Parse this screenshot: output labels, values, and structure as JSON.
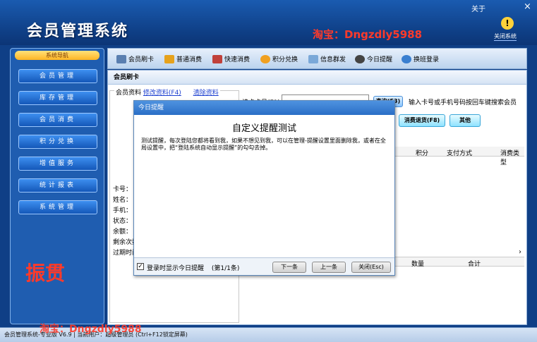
{
  "header": {
    "app_title": "会员管理系统",
    "watermark_shop": "淘宝：Dngzdly5988",
    "about": "关于",
    "close_x": "×",
    "warn_glyph": "!",
    "close_system": "关闭系统"
  },
  "sidebar": {
    "heading": "系统导航",
    "items": [
      "会员管理",
      "库存管理",
      "会员消费",
      "积分兑换",
      "增值服务",
      "统计报表",
      "系统管理"
    ]
  },
  "toolbar": {
    "items": [
      {
        "label": "会员刷卡",
        "icon": "card-icon",
        "color": "#5a7fb0"
      },
      {
        "label": "普通消费",
        "icon": "cash-icon",
        "color": "#e6a21c"
      },
      {
        "label": "快速消费",
        "icon": "fast-icon",
        "color": "#c0403a"
      },
      {
        "label": "积分兑换",
        "icon": "points-icon",
        "color": "#f0a020"
      },
      {
        "label": "信息群发",
        "icon": "mail-icon",
        "color": "#7aa8d8"
      },
      {
        "label": "今日提醒",
        "icon": "clock-icon",
        "color": "#444444"
      },
      {
        "label": "换班登录",
        "icon": "switch-icon",
        "color": "#3a7fd0"
      }
    ]
  },
  "main": {
    "title": "会员刷卡",
    "member_legend": "会员资料",
    "edit_link": "修改资料(F4)",
    "clear_link": "清除资料",
    "fields": [
      "卡号：",
      "姓名：",
      "手机：",
      "状态：",
      "余额：",
      "剩余次数：",
      "过期时间："
    ],
    "search_label": "读卡卡号(F1)",
    "search_button": "查询(F3)",
    "search_hint": "输入卡号或手机号码按回车键搜索会员",
    "refund_button": "消费退货(F8)",
    "other_button": "其他",
    "grid_headers": [
      "积分",
      "支付方式",
      "消费类型"
    ],
    "grid_bottom_headers": [
      "数量",
      "合计"
    ],
    "scroll_right": "›"
  },
  "dialog": {
    "title": "今日提醒",
    "heading": "自定义提醒测试",
    "text": "测试提醒，每次登陆您都将看到我，如果不想见到我，可以在管理-提醒设置里面删除我，或者在全局设置中，把“登陆系统自动显示提醒”的勾勾去掉。",
    "checkbox_checked": "✓",
    "checkbox_label": "登录时显示今日提醒",
    "counter": "(第1/1条)",
    "next_button": "下一条",
    "prev_button": "上一条",
    "close_button": "关闭(Esc)"
  },
  "watermark_brand": "振贯",
  "statusbar": {
    "text": "会员管理系统-专业版 V6.9 | 当前用户：超级管理员 (Ctrl+F12锁定屏幕)",
    "watermark": "淘宝：Dngzdly5988"
  }
}
